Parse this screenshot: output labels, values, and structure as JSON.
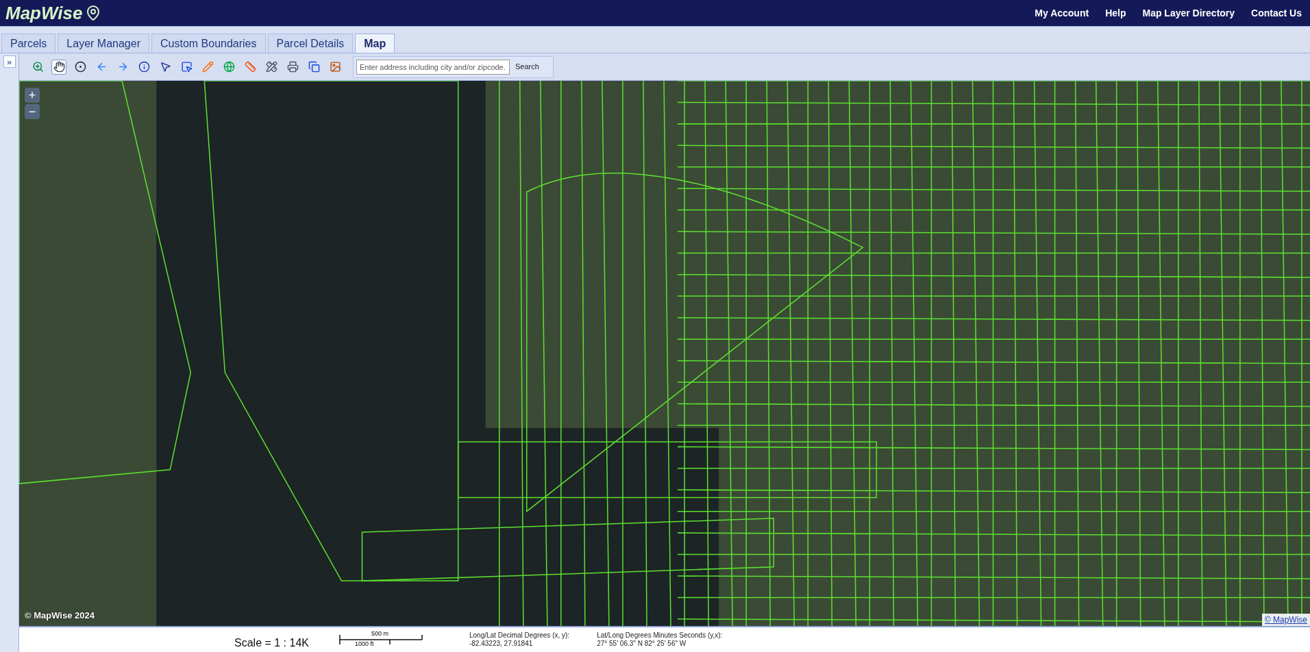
{
  "header": {
    "logo": "MapWise",
    "nav": [
      "My Account",
      "Help",
      "Map Layer Directory",
      "Contact Us"
    ]
  },
  "tabs": [
    {
      "label": "Parcels",
      "selected": false
    },
    {
      "label": "Layer Manager",
      "selected": false
    },
    {
      "label": "Custom Boundaries",
      "selected": false
    },
    {
      "label": "Parcel Details",
      "selected": false
    },
    {
      "label": "Map",
      "selected": true
    }
  ],
  "sidebar_toggle": "»",
  "toolbar": {
    "tools": [
      {
        "selected": false
      },
      {
        "selected": true
      },
      {
        "selected": false
      },
      {
        "selected": false
      },
      {
        "selected": false
      },
      {
        "selected": false
      },
      {
        "selected": false
      },
      {
        "selected": false
      },
      {
        "selected": false
      },
      {
        "selected": false
      },
      {
        "selected": false
      },
      {
        "selected": false
      },
      {
        "selected": false
      },
      {
        "selected": false
      },
      {
        "selected": false
      }
    ],
    "search": {
      "placeholder": "Enter address including city and/or zipcode.",
      "button": "Search"
    }
  },
  "map": {
    "zoom": [
      "+",
      "−"
    ],
    "copyright_left": "© MapWise 2024",
    "copyright_right": "© MapWise"
  },
  "status_bar": {
    "scale": "Scale = 1 : 14K",
    "scalebar": [
      "500 m",
      "1000 ft"
    ],
    "coords": [
      {
        "label": "Long/Lat Decimal Degrees (x, y):",
        "value": "-82.43223, 27.91841"
      },
      {
        "label": "Lat/Long Degrees Minutes Seconds (y,x):",
        "value": "27° 55' 06.3\" N 82° 25' 56\" W"
      }
    ]
  }
}
